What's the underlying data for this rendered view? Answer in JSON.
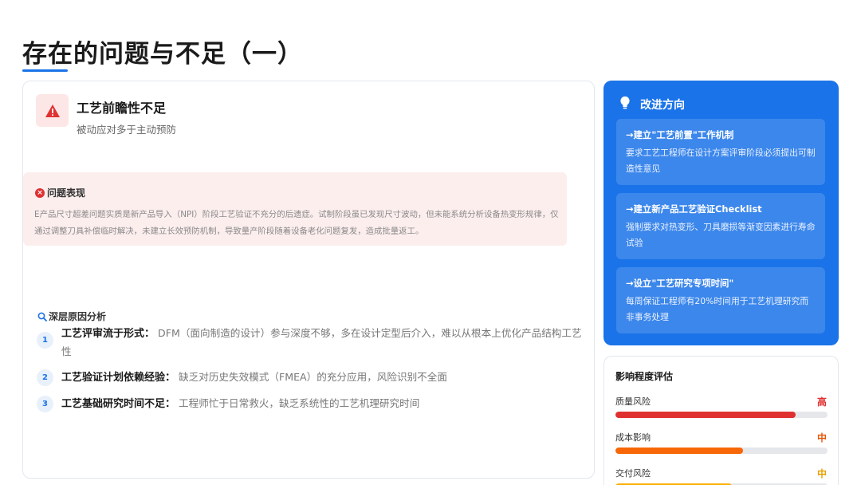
{
  "page": {
    "title": "存在的问题与不足（一）"
  },
  "main_card": {
    "heading": "工艺前瞻性不足",
    "subheading": "被动应对多于主动预防",
    "problem": {
      "title": "问题表现",
      "text": "E产品尺寸超差问题实质是新产品导入（NPI）阶段工艺验证不充分的后遗症。试制阶段虽已发现尺寸波动，但未能系统分析设备热变形规律，仅通过调整刀具补偿临时解决，未建立长效预防机制，导致量产阶段随着设备老化问题复发，造成批量返工。"
    },
    "causes": {
      "title": "深层原因分析",
      "items": [
        {
          "num": "1",
          "label": "工艺评审流于形式：",
          "text": "DFM（面向制造的设计）参与深度不够，多在设计定型后介入，难以从根本上优化产品结构工艺性"
        },
        {
          "num": "2",
          "label": "工艺验证计划依赖经验：",
          "text": "缺乏对历史失效模式（FMEA）的充分应用，风险识别不全面"
        },
        {
          "num": "3",
          "label": "工艺基础研究时间不足：",
          "text": "工程师忙于日常救火，缺乏系统性的工艺机理研究时间"
        }
      ]
    }
  },
  "improvement": {
    "title": "改进方向",
    "items": [
      {
        "title": "→建立\"工艺前置\"工作机制",
        "desc": "要求工艺工程师在设计方案评审阶段必须提出可制造性意见"
      },
      {
        "title": "→建立新产品工艺验证Checklist",
        "desc": "强制要求对热变形、刀具磨损等渐变因素进行寿命试验"
      },
      {
        "title": "→设立\"工艺研究专项时间\"",
        "desc": "每周保证工程师有20%时间用于工艺机理研究而非事务处理"
      }
    ]
  },
  "impact": {
    "title": "影响程度评估",
    "metrics": [
      {
        "label": "质量风险",
        "level": "高",
        "fraction": 0.85,
        "color": "#e03131",
        "level_color": "#e03131"
      },
      {
        "label": "成本影响",
        "level": "中",
        "fraction": 0.6,
        "color": "#f76707",
        "level_color": "#e8590c"
      },
      {
        "label": "交付风险",
        "level": "中",
        "fraction": 0.55,
        "color": "#fab005",
        "level_color": "#e8a000"
      }
    ]
  },
  "icons": {
    "warning": "warning-triangle-icon",
    "problem": "x-circle-icon",
    "search": "search-icon",
    "bulb": "lightbulb-icon"
  }
}
